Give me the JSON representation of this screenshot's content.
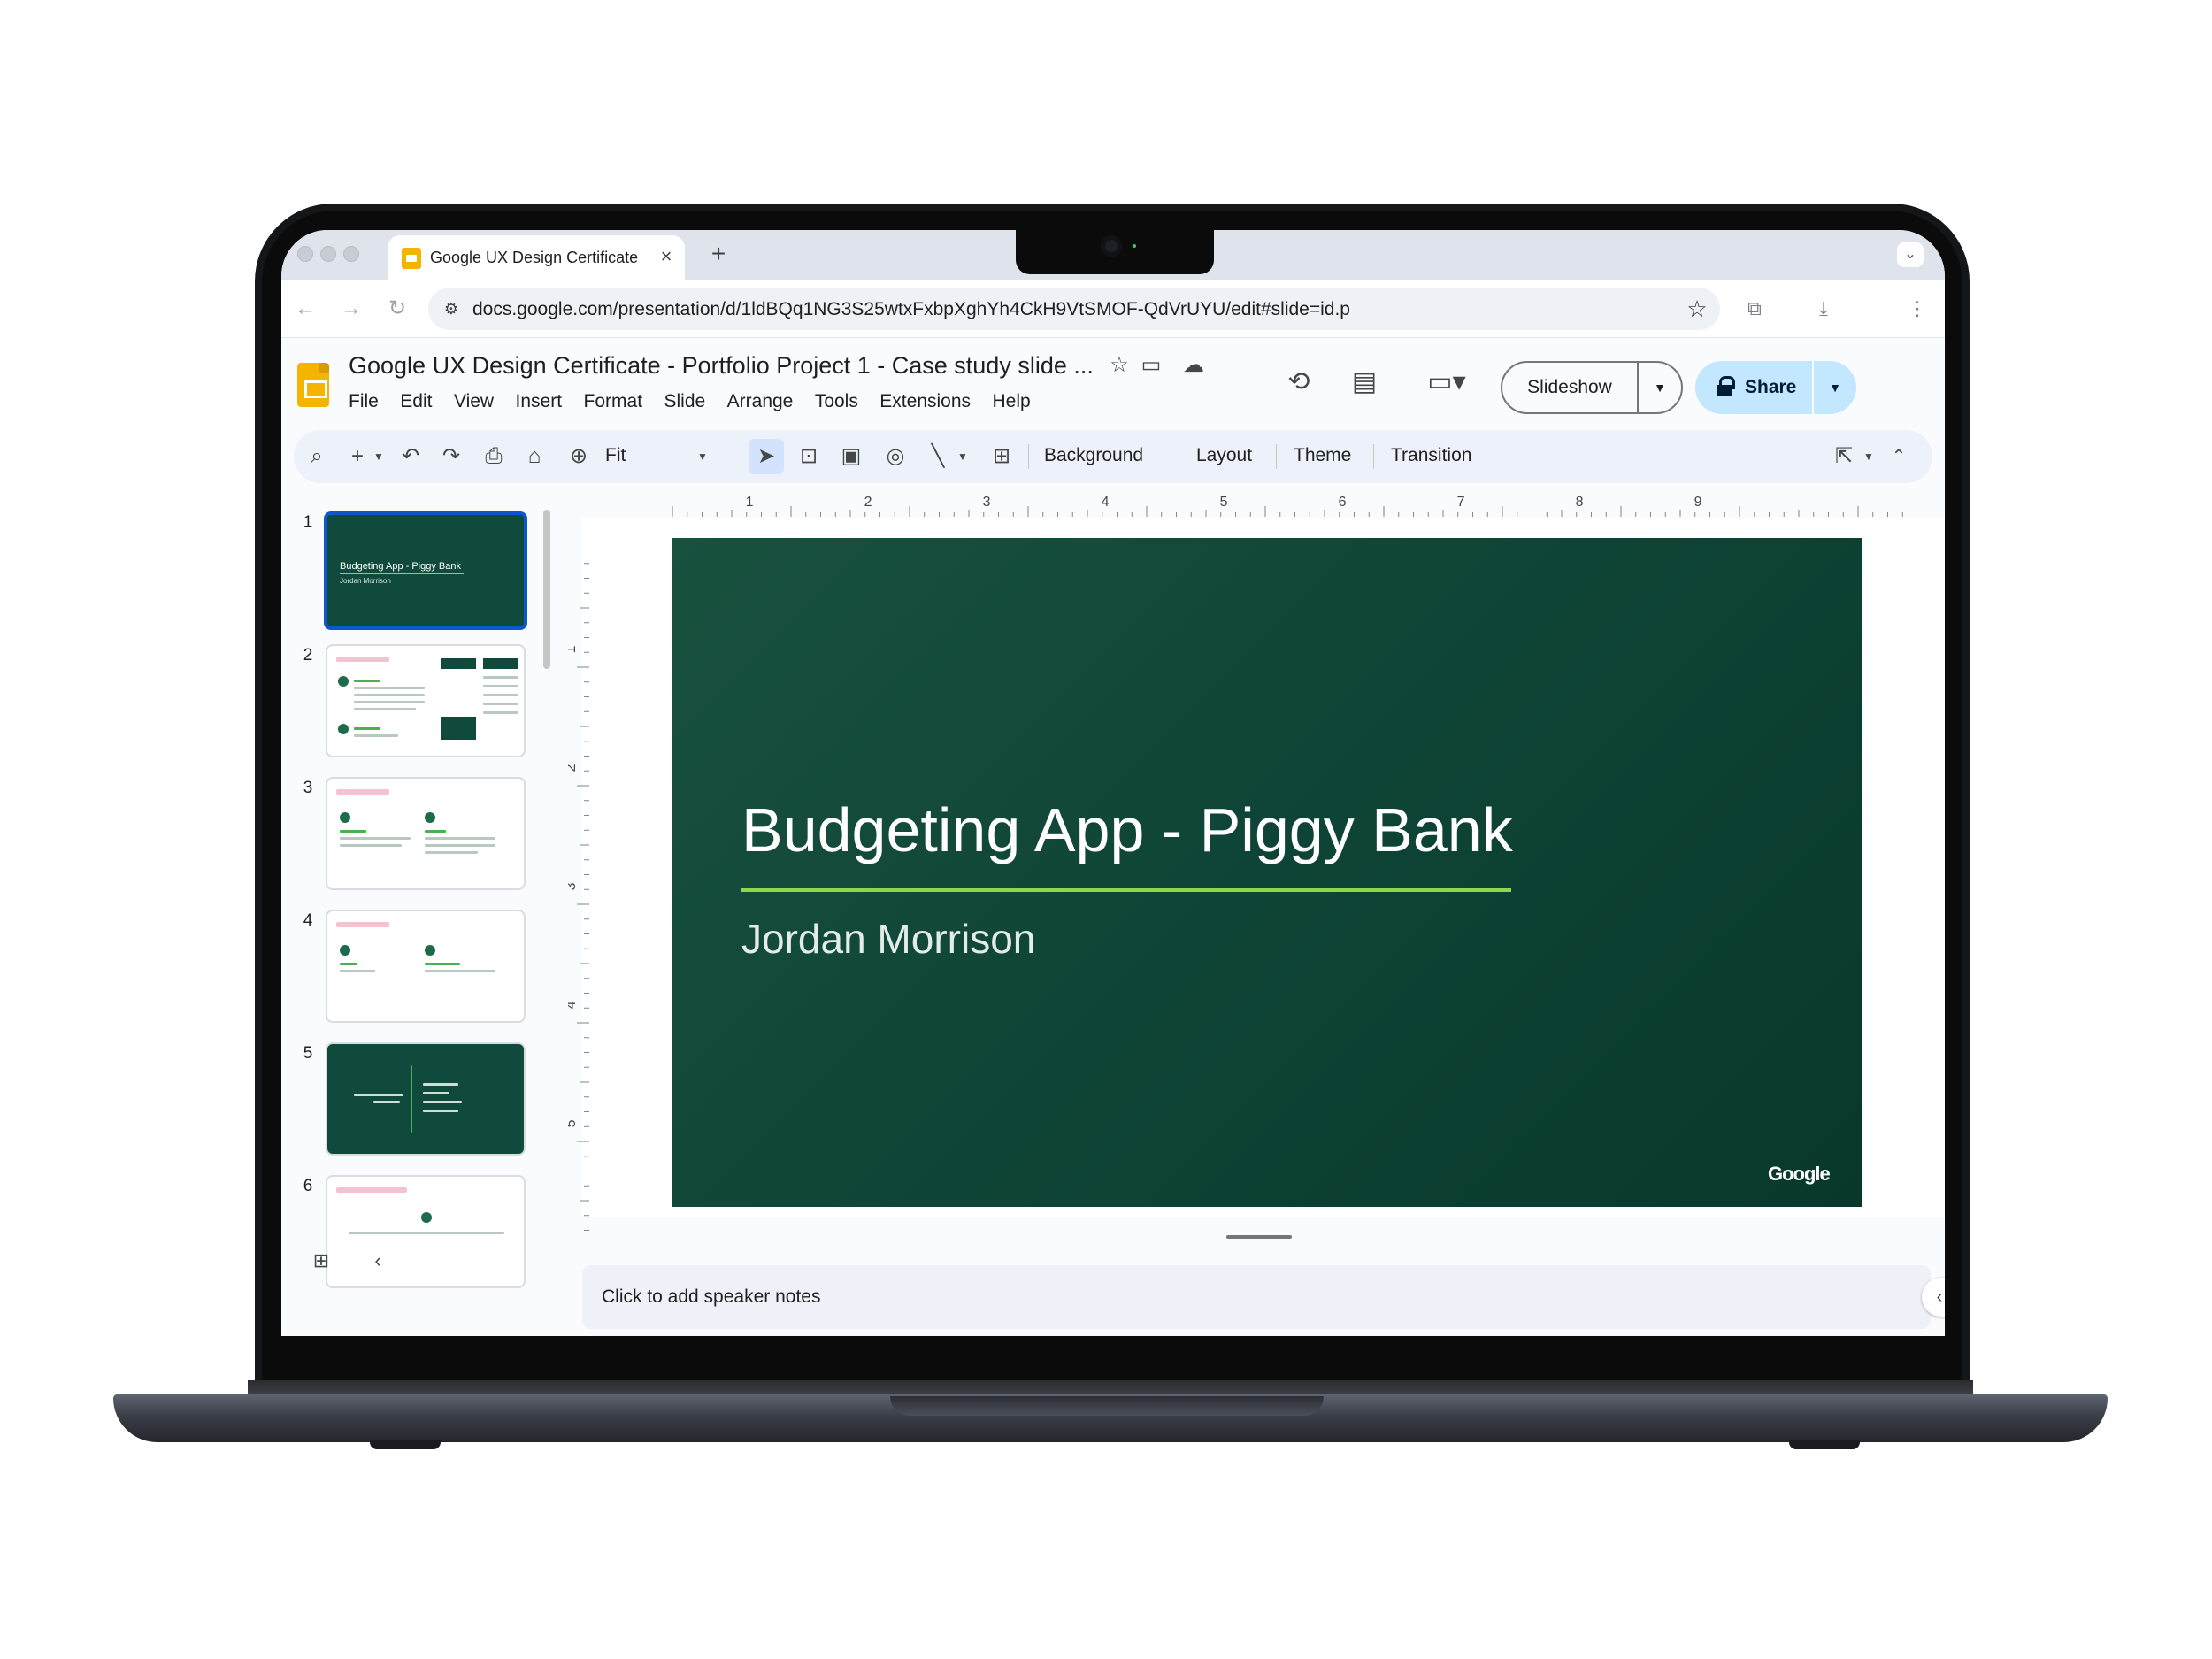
{
  "browser": {
    "tab_title": "Google UX Design Certificate",
    "tab_close": "×",
    "new_tab": "+",
    "url": "docs.google.com/presentation/d/1ldBQq1NG3S25wtxFxbpXghYh4CkH9VtSMOF-QdVrUYU/edit#slide=id.p"
  },
  "app": {
    "title": "Google UX Design Certificate - Portfolio Project 1 - Case study slide ...",
    "menu": [
      "File",
      "Edit",
      "View",
      "Insert",
      "Format",
      "Slide",
      "Arrange",
      "Tools",
      "Extensions",
      "Help"
    ],
    "slideshow_label": "Slideshow",
    "share_label": "Share"
  },
  "toolbar": {
    "zoom_label": "Fit",
    "background_label": "Background",
    "layout_label": "Layout",
    "theme_label": "Theme",
    "transition_label": "Transition"
  },
  "filmstrip": {
    "slide_numbers": [
      "1",
      "2",
      "3",
      "4",
      "5",
      "6"
    ],
    "thumb1_title": "Budgeting App - Piggy Bank",
    "thumb1_sub": "Jordan Morrison"
  },
  "ruler": {
    "h_labels": [
      "1",
      "2",
      "3",
      "4",
      "5",
      "6",
      "7",
      "8",
      "9"
    ],
    "v_labels": [
      "1",
      "2",
      "3",
      "4",
      "5"
    ]
  },
  "slide": {
    "title": "Budgeting App - Piggy Bank",
    "subtitle": "Jordan Morrison",
    "brand": "Google",
    "background_color": "#0e4437",
    "accent_color": "#8bd94a"
  },
  "notes": {
    "placeholder": "Click to add speaker notes"
  }
}
